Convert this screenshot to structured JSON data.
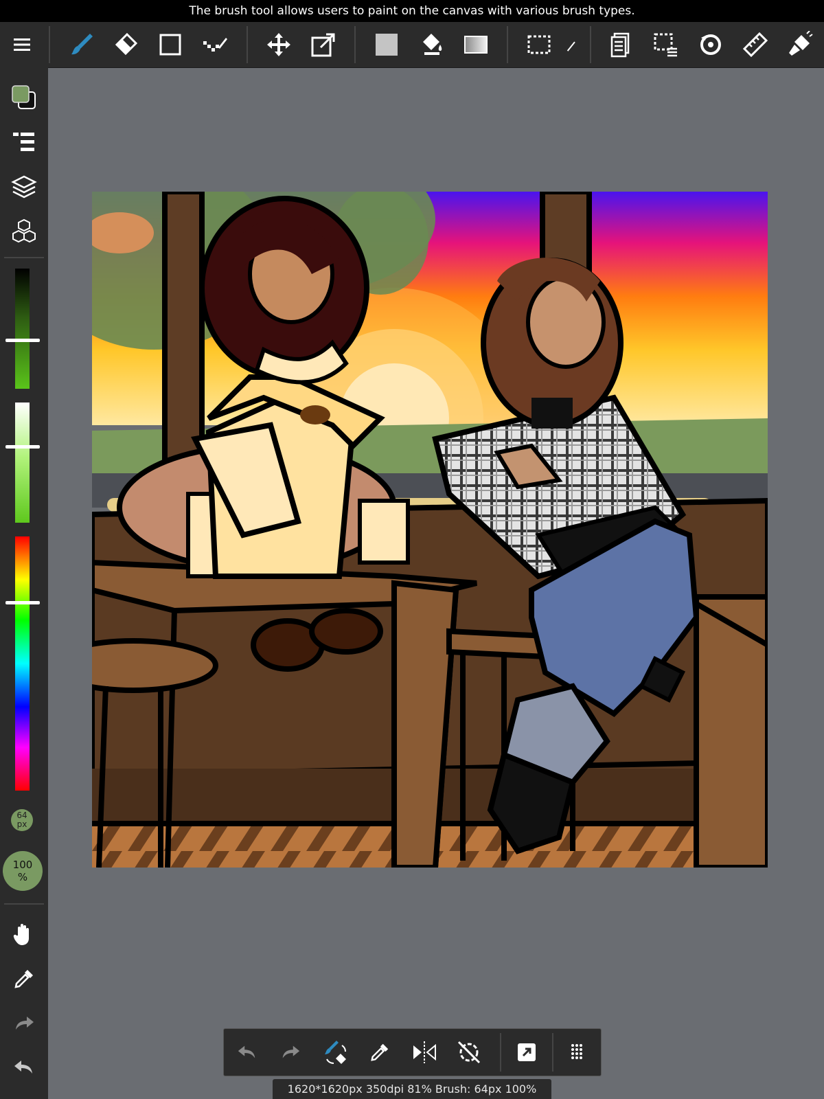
{
  "tooltip": "The brush tool allows users to paint on the canvas with various brush types.",
  "brush": {
    "size_value": "64",
    "size_unit": "px",
    "opacity_value": "100",
    "opacity_unit": "%"
  },
  "status": "1620*1620px 350dpi 81% Brush: 64px 100%",
  "colors": {
    "active_tool": "#2e8bc0",
    "primary_color": "#7a9a62",
    "secondary_color": "#111111"
  },
  "top_toolbar": {
    "items": [
      "menu-icon",
      "brush-icon",
      "eraser-icon",
      "shape-icon",
      "dot-pen-icon",
      "move-icon",
      "transform-icon",
      "fill-color-icon",
      "bucket-icon",
      "gradient-icon",
      "select-rect-icon",
      "magic-wand-icon",
      "copy-layer-icon",
      "select-dotted-icon",
      "rotate-icon",
      "ruler-icon",
      "filter-icon"
    ]
  },
  "left_sidebar": {
    "items": [
      "color-swatch",
      "layers-list-icon",
      "layers-icon",
      "materials-icon",
      "hand-icon",
      "eyedropper-icon",
      "redo-icon",
      "undo-icon"
    ],
    "sliders": [
      "brightness-slider",
      "saturation-slider",
      "hue-slider"
    ]
  },
  "bottom_toolbar": {
    "items": [
      "undo-icon",
      "redo-icon",
      "brush-eraser-toggle-icon",
      "eyedropper-icon",
      "flip-icon",
      "rotate-reset-icon",
      "export-icon",
      "grid-menu-icon"
    ]
  }
}
